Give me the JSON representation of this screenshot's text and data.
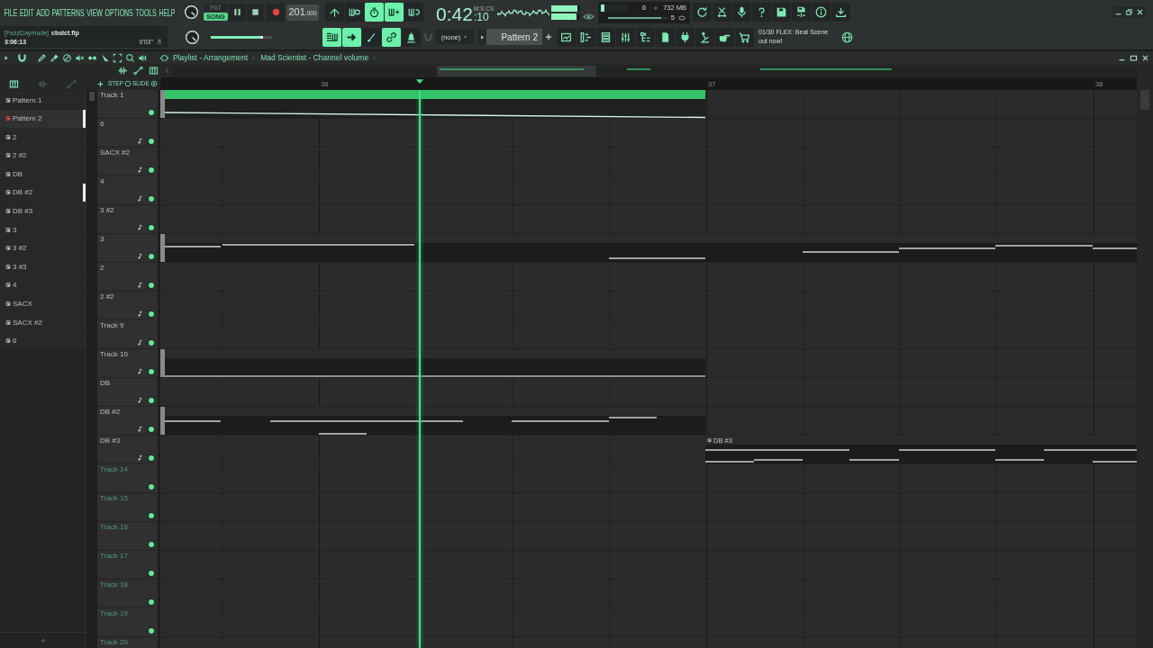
{
  "menu": [
    "FILE",
    "EDIT",
    "ADD",
    "PATTERNS",
    "VIEW",
    "OPTIONS",
    "TOOLS",
    "HELP"
  ],
  "project": {
    "user": "[FezzDaymude]",
    "file": "cbslct.flp",
    "position": "3:06:13",
    "length": "0'03\""
  },
  "transport": {
    "modes": [
      {
        "label": "PAT",
        "selected": false
      },
      {
        "label": "SONG",
        "selected": true
      }
    ],
    "playing": true,
    "tempo": "201",
    "tempo_fraction": ".000",
    "toggles": [
      {
        "on": false
      },
      {
        "on": false
      },
      {
        "on": true
      },
      {
        "on": true
      },
      {
        "on": false
      }
    ]
  },
  "time": {
    "value": "0:42",
    "fraction": ":10",
    "unit": "M:S:CS"
  },
  "meters": [
    {
      "level": 0.92
    },
    {
      "level": 0.86
    }
  ],
  "monitor": {
    "cpu": {
      "level": 0.12
    },
    "value_1": "6",
    "memory": "732 MB",
    "load": {
      "level": 0.9
    },
    "polyphony": "5"
  },
  "main_volume": {
    "level": 0.86
  },
  "tools": {
    "toggles": [
      {
        "on": true
      },
      {
        "on": true
      },
      {
        "on": false
      },
      {
        "on": true
      },
      {
        "on": false
      }
    ],
    "snap": "(none)",
    "pattern": "Pattern 2"
  },
  "news": "01/30 FLEX: Beat Scene out now!",
  "playlist": {
    "title": "Playlist - Arrangement",
    "breadcrumb": "Mad Scientist - Channel volume",
    "filters": [
      {
        "selected": true
      },
      {
        "selected": false
      },
      {
        "selected": false
      }
    ],
    "step": "STEP",
    "slide": "SLIDE",
    "ruler": [
      "36",
      "37",
      "38"
    ],
    "patterns": [
      {
        "name": "Pattern 1",
        "selected": false,
        "marked": false
      },
      {
        "name": "Pattern 2",
        "selected": true,
        "marked": true
      },
      {
        "name": "2",
        "selected": false,
        "marked": false
      },
      {
        "name": "2 #2",
        "selected": false,
        "marked": false
      },
      {
        "name": "DB",
        "selected": false,
        "marked": false
      },
      {
        "name": "DB #2",
        "selected": false,
        "marked": true
      },
      {
        "name": "DB #3",
        "selected": false,
        "marked": false
      },
      {
        "name": "3",
        "selected": false,
        "marked": false
      },
      {
        "name": "3 #2",
        "selected": false,
        "marked": false
      },
      {
        "name": "3 #3",
        "selected": false,
        "marked": false
      },
      {
        "name": "4",
        "selected": false,
        "marked": false
      },
      {
        "name": "SACX",
        "selected": false,
        "marked": false
      },
      {
        "name": "SACX #2",
        "selected": false,
        "marked": false
      },
      {
        "name": "6",
        "selected": false,
        "marked": false
      }
    ],
    "tracks": [
      {
        "name": "Track 1",
        "empty": false,
        "note_icon": false,
        "on": true,
        "clip": {
          "kind": "automation",
          "cut_left": true,
          "cut_right": false,
          "selected": true
        }
      },
      {
        "name": "6",
        "empty": false,
        "note_icon": true,
        "on": true
      },
      {
        "name": "SACX #2",
        "empty": false,
        "note_icon": true,
        "on": true
      },
      {
        "name": "4",
        "empty": false,
        "note_icon": true,
        "on": true
      },
      {
        "name": "3 #2",
        "empty": false,
        "note_icon": true,
        "on": true
      },
      {
        "name": "3",
        "empty": false,
        "note_icon": true,
        "on": true,
        "clip": {
          "kind": "pattern",
          "cut_left": true,
          "cut_right": true,
          "selected": false
        }
      },
      {
        "name": "2",
        "empty": false,
        "note_icon": true,
        "on": true
      },
      {
        "name": "2 #2",
        "empty": false,
        "note_icon": true,
        "on": true
      },
      {
        "name": "Track 9",
        "empty": false,
        "note_icon": true,
        "on": true
      },
      {
        "name": "Track 10",
        "empty": false,
        "note_icon": true,
        "on": true,
        "clip": {
          "kind": "automation",
          "cut_left": true,
          "cut_right": false,
          "selected": false
        }
      },
      {
        "name": "DB",
        "empty": false,
        "note_icon": true,
        "on": true
      },
      {
        "name": "DB #2",
        "empty": false,
        "note_icon": true,
        "on": true,
        "clip": {
          "kind": "pattern",
          "cut_left": true,
          "cut_right": false,
          "selected": false
        }
      },
      {
        "name": "DB #3",
        "empty": false,
        "note_icon": true,
        "on": true,
        "clip": {
          "kind": "pattern",
          "cut_left": false,
          "cut_right": true,
          "selected": false,
          "label": "DB #3"
        }
      },
      {
        "name": "Track 14",
        "empty": true,
        "note_icon": false,
        "on": true
      },
      {
        "name": "Track 15",
        "empty": true,
        "note_icon": false,
        "on": true
      },
      {
        "name": "Track 16",
        "empty": true,
        "note_icon": false,
        "on": true
      },
      {
        "name": "Track 17",
        "empty": true,
        "note_icon": false,
        "on": true
      },
      {
        "name": "Track 18",
        "empty": true,
        "note_icon": false,
        "on": true
      },
      {
        "name": "Track 19",
        "empty": true,
        "note_icon": false,
        "on": true
      },
      {
        "name": "Track 20",
        "empty": true,
        "note_icon": false
      }
    ]
  }
}
